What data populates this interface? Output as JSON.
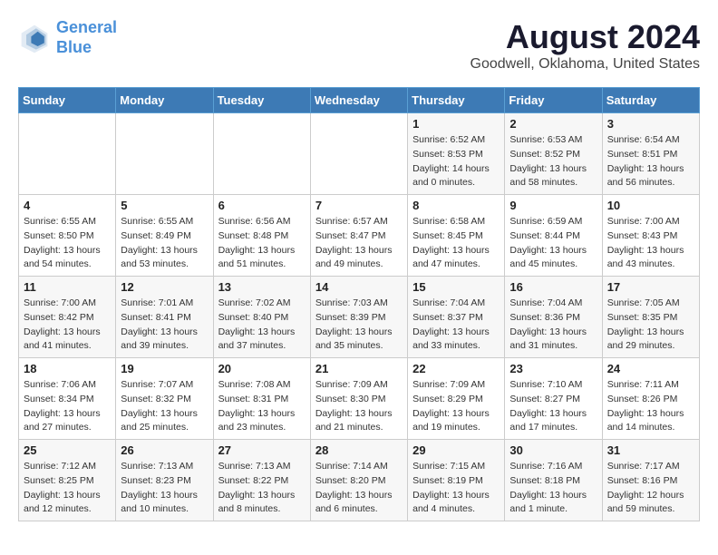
{
  "header": {
    "logo_line1": "General",
    "logo_line2": "Blue",
    "title": "August 2024",
    "subtitle": "Goodwell, Oklahoma, United States"
  },
  "weekdays": [
    "Sunday",
    "Monday",
    "Tuesday",
    "Wednesday",
    "Thursday",
    "Friday",
    "Saturday"
  ],
  "weeks": [
    [
      {
        "day": "",
        "info": ""
      },
      {
        "day": "",
        "info": ""
      },
      {
        "day": "",
        "info": ""
      },
      {
        "day": "",
        "info": ""
      },
      {
        "day": "1",
        "info": "Sunrise: 6:52 AM\nSunset: 8:53 PM\nDaylight: 14 hours\nand 0 minutes."
      },
      {
        "day": "2",
        "info": "Sunrise: 6:53 AM\nSunset: 8:52 PM\nDaylight: 13 hours\nand 58 minutes."
      },
      {
        "day": "3",
        "info": "Sunrise: 6:54 AM\nSunset: 8:51 PM\nDaylight: 13 hours\nand 56 minutes."
      }
    ],
    [
      {
        "day": "4",
        "info": "Sunrise: 6:55 AM\nSunset: 8:50 PM\nDaylight: 13 hours\nand 54 minutes."
      },
      {
        "day": "5",
        "info": "Sunrise: 6:55 AM\nSunset: 8:49 PM\nDaylight: 13 hours\nand 53 minutes."
      },
      {
        "day": "6",
        "info": "Sunrise: 6:56 AM\nSunset: 8:48 PM\nDaylight: 13 hours\nand 51 minutes."
      },
      {
        "day": "7",
        "info": "Sunrise: 6:57 AM\nSunset: 8:47 PM\nDaylight: 13 hours\nand 49 minutes."
      },
      {
        "day": "8",
        "info": "Sunrise: 6:58 AM\nSunset: 8:45 PM\nDaylight: 13 hours\nand 47 minutes."
      },
      {
        "day": "9",
        "info": "Sunrise: 6:59 AM\nSunset: 8:44 PM\nDaylight: 13 hours\nand 45 minutes."
      },
      {
        "day": "10",
        "info": "Sunrise: 7:00 AM\nSunset: 8:43 PM\nDaylight: 13 hours\nand 43 minutes."
      }
    ],
    [
      {
        "day": "11",
        "info": "Sunrise: 7:00 AM\nSunset: 8:42 PM\nDaylight: 13 hours\nand 41 minutes."
      },
      {
        "day": "12",
        "info": "Sunrise: 7:01 AM\nSunset: 8:41 PM\nDaylight: 13 hours\nand 39 minutes."
      },
      {
        "day": "13",
        "info": "Sunrise: 7:02 AM\nSunset: 8:40 PM\nDaylight: 13 hours\nand 37 minutes."
      },
      {
        "day": "14",
        "info": "Sunrise: 7:03 AM\nSunset: 8:39 PM\nDaylight: 13 hours\nand 35 minutes."
      },
      {
        "day": "15",
        "info": "Sunrise: 7:04 AM\nSunset: 8:37 PM\nDaylight: 13 hours\nand 33 minutes."
      },
      {
        "day": "16",
        "info": "Sunrise: 7:04 AM\nSunset: 8:36 PM\nDaylight: 13 hours\nand 31 minutes."
      },
      {
        "day": "17",
        "info": "Sunrise: 7:05 AM\nSunset: 8:35 PM\nDaylight: 13 hours\nand 29 minutes."
      }
    ],
    [
      {
        "day": "18",
        "info": "Sunrise: 7:06 AM\nSunset: 8:34 PM\nDaylight: 13 hours\nand 27 minutes."
      },
      {
        "day": "19",
        "info": "Sunrise: 7:07 AM\nSunset: 8:32 PM\nDaylight: 13 hours\nand 25 minutes."
      },
      {
        "day": "20",
        "info": "Sunrise: 7:08 AM\nSunset: 8:31 PM\nDaylight: 13 hours\nand 23 minutes."
      },
      {
        "day": "21",
        "info": "Sunrise: 7:09 AM\nSunset: 8:30 PM\nDaylight: 13 hours\nand 21 minutes."
      },
      {
        "day": "22",
        "info": "Sunrise: 7:09 AM\nSunset: 8:29 PM\nDaylight: 13 hours\nand 19 minutes."
      },
      {
        "day": "23",
        "info": "Sunrise: 7:10 AM\nSunset: 8:27 PM\nDaylight: 13 hours\nand 17 minutes."
      },
      {
        "day": "24",
        "info": "Sunrise: 7:11 AM\nSunset: 8:26 PM\nDaylight: 13 hours\nand 14 minutes."
      }
    ],
    [
      {
        "day": "25",
        "info": "Sunrise: 7:12 AM\nSunset: 8:25 PM\nDaylight: 13 hours\nand 12 minutes."
      },
      {
        "day": "26",
        "info": "Sunrise: 7:13 AM\nSunset: 8:23 PM\nDaylight: 13 hours\nand 10 minutes."
      },
      {
        "day": "27",
        "info": "Sunrise: 7:13 AM\nSunset: 8:22 PM\nDaylight: 13 hours\nand 8 minutes."
      },
      {
        "day": "28",
        "info": "Sunrise: 7:14 AM\nSunset: 8:20 PM\nDaylight: 13 hours\nand 6 minutes."
      },
      {
        "day": "29",
        "info": "Sunrise: 7:15 AM\nSunset: 8:19 PM\nDaylight: 13 hours\nand 4 minutes."
      },
      {
        "day": "30",
        "info": "Sunrise: 7:16 AM\nSunset: 8:18 PM\nDaylight: 13 hours\nand 1 minute."
      },
      {
        "day": "31",
        "info": "Sunrise: 7:17 AM\nSunset: 8:16 PM\nDaylight: 12 hours\nand 59 minutes."
      }
    ]
  ]
}
